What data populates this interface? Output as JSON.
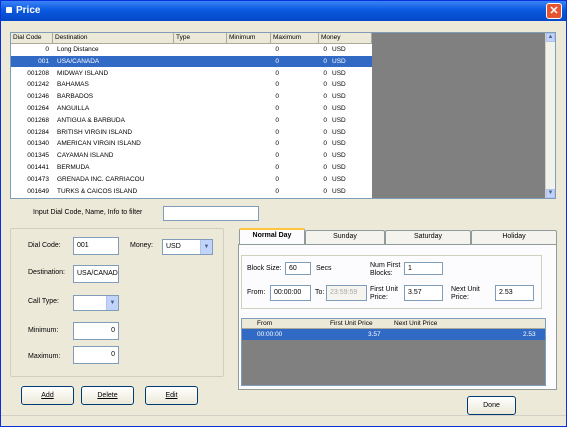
{
  "window": {
    "title": "Price",
    "close_symbol": "✕"
  },
  "grid": {
    "columns": [
      "Dial Code",
      "Destination",
      "Type",
      "Minimum",
      "Maximum",
      "Money"
    ],
    "rows": [
      {
        "code": "0",
        "dest": "Long Distance",
        "type": "",
        "min": "0",
        "max": "0",
        "money": "USD",
        "selected": false
      },
      {
        "code": "001",
        "dest": "USA/CANADA",
        "type": "",
        "min": "0",
        "max": "0",
        "money": "USD",
        "selected": true
      },
      {
        "code": "001208",
        "dest": "MIDWAY ISLAND",
        "type": "",
        "min": "0",
        "max": "0",
        "money": "USD",
        "selected": false
      },
      {
        "code": "001242",
        "dest": "BAHAMAS",
        "type": "",
        "min": "0",
        "max": "0",
        "money": "USD",
        "selected": false
      },
      {
        "code": "001246",
        "dest": "BARBADOS",
        "type": "",
        "min": "0",
        "max": "0",
        "money": "USD",
        "selected": false
      },
      {
        "code": "001264",
        "dest": "ANGUILLA",
        "type": "",
        "min": "0",
        "max": "0",
        "money": "USD",
        "selected": false
      },
      {
        "code": "001268",
        "dest": "ANTIGUA & BARBUDA",
        "type": "",
        "min": "0",
        "max": "0",
        "money": "USD",
        "selected": false
      },
      {
        "code": "001284",
        "dest": "BRITISH VIRGIN ISLAND",
        "type": "",
        "min": "0",
        "max": "0",
        "money": "USD",
        "selected": false
      },
      {
        "code": "001340",
        "dest": "AMERICAN VIRGIN ISLAND",
        "type": "",
        "min": "0",
        "max": "0",
        "money": "USD",
        "selected": false
      },
      {
        "code": "001345",
        "dest": "CAYAMAN ISLAND",
        "type": "",
        "min": "0",
        "max": "0",
        "money": "USD",
        "selected": false
      },
      {
        "code": "001441",
        "dest": "BERMUDA",
        "type": "",
        "min": "0",
        "max": "0",
        "money": "USD",
        "selected": false
      },
      {
        "code": "001473",
        "dest": "GRENADA INC. CARRIACOU",
        "type": "",
        "min": "0",
        "max": "0",
        "money": "USD",
        "selected": false
      },
      {
        "code": "001649",
        "dest": "TURKS & CAICOS ISLAND",
        "type": "",
        "min": "0",
        "max": "0",
        "money": "USD",
        "selected": false
      }
    ]
  },
  "filter": {
    "label": "Input Dial Code, Name, Info to filter",
    "value": ""
  },
  "form": {
    "dial_code_label": "Dial Code:",
    "dial_code": "001",
    "money_label": "Money:",
    "money": "USD",
    "destination_label": "Destination:",
    "destination": "USA/CANAD",
    "call_type_label": "Call Type:",
    "call_type": "",
    "minimum_label": "Minimum:",
    "minimum": "0",
    "maximum_label": "Maximum:",
    "maximum": "0"
  },
  "tabs": [
    "Normal Day",
    "Sunday",
    "Saturday",
    "Holiday"
  ],
  "rate": {
    "block_size_label": "Block Size:",
    "block_size": "60",
    "secs_label": "Secs",
    "num_first_label": "Num First Blocks:",
    "num_first": "1",
    "from_label": "From:",
    "from": "00:00:00",
    "to_label": "To:",
    "to": "23:59:59",
    "first_unit_label": "First Unit Price:",
    "first_unit": "3.57",
    "next_unit_label": "Next Unit Price:",
    "next_unit": "2.53"
  },
  "unit_grid": {
    "columns": [
      "From",
      "First Unit Price",
      "Next Unit Price"
    ],
    "row": {
      "from": "00:00:00",
      "first": "3.57",
      "next": "2.53"
    }
  },
  "buttons": {
    "add": "Add",
    "delete": "Delete",
    "edit": "Edit",
    "done": "Done"
  },
  "icons": {
    "scroll_up": "▲",
    "scroll_down": "▼",
    "dropdown": "▼"
  },
  "colors": {
    "titlebar": "#0a5ae0",
    "selection": "#316ac5",
    "close": "#e5532f"
  }
}
